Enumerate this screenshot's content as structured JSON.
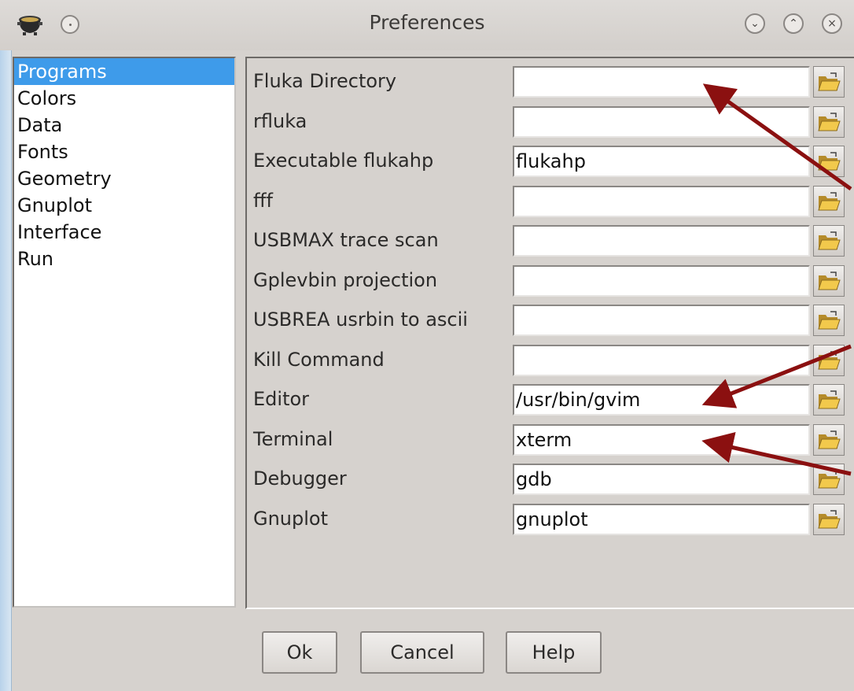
{
  "window": {
    "title": "Preferences",
    "controls": {
      "minimize": "⌄",
      "maximize": "⌃",
      "close": "×"
    }
  },
  "categories": [
    {
      "label": "Programs",
      "selected": true
    },
    {
      "label": "Colors",
      "selected": false
    },
    {
      "label": "Data",
      "selected": false
    },
    {
      "label": "Fonts",
      "selected": false
    },
    {
      "label": "Geometry",
      "selected": false
    },
    {
      "label": "Gnuplot",
      "selected": false
    },
    {
      "label": "Interface",
      "selected": false
    },
    {
      "label": "Run",
      "selected": false
    }
  ],
  "fields": [
    {
      "label": "Fluka Directory",
      "value": ""
    },
    {
      "label": "rfluka",
      "value": ""
    },
    {
      "label": "Executable flukahp",
      "value": "flukahp"
    },
    {
      "label": "fff",
      "value": ""
    },
    {
      "label": "USBMAX trace scan",
      "value": ""
    },
    {
      "label": "Gplevbin projection",
      "value": ""
    },
    {
      "label": "USBREA usrbin to ascii",
      "value": ""
    },
    {
      "label": "Kill Command",
      "value": ""
    },
    {
      "label": "Editor",
      "value": "/usr/bin/gvim"
    },
    {
      "label": "Terminal",
      "value": "xterm"
    },
    {
      "label": "Debugger",
      "value": "gdb"
    },
    {
      "label": "Gnuplot",
      "value": "gnuplot"
    }
  ],
  "buttons": {
    "ok": "Ok",
    "cancel": "Cancel",
    "help": "Help"
  },
  "icons": {
    "app": "cauldron-icon",
    "browse": "folder-open-icon"
  },
  "colors": {
    "selection": "#3e9bea",
    "arrow": "#8b1010",
    "window_bg": "#d6d2ce"
  }
}
